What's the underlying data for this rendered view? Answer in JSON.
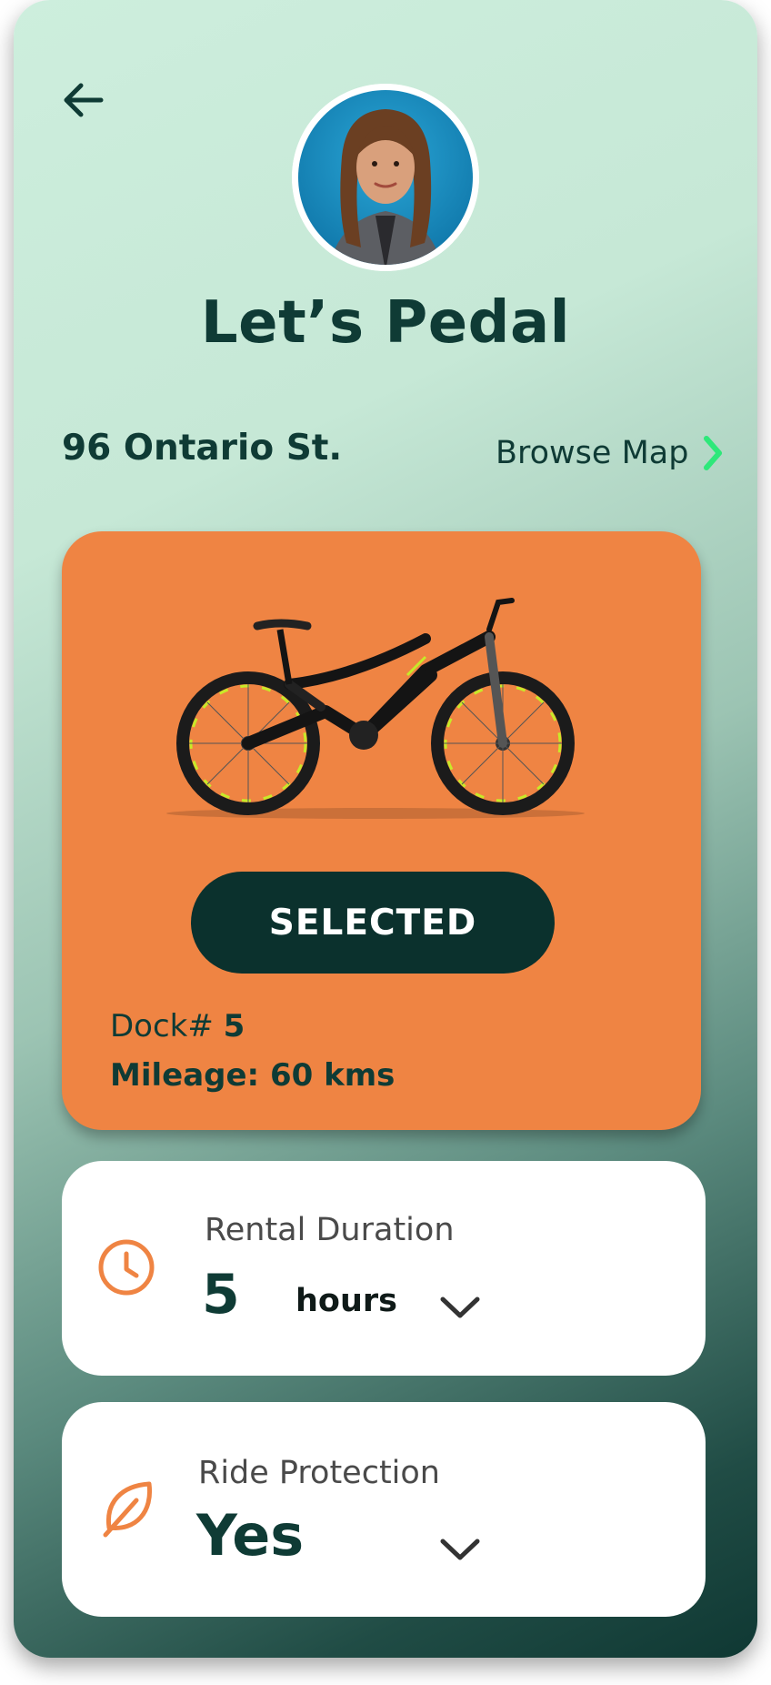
{
  "header": {
    "back_icon": "arrow-left-icon",
    "title": "Let’s Pedal"
  },
  "location": {
    "address": "96 Ontario St.",
    "browse_label": "Browse Map",
    "browse_icon": "chevron-right-icon"
  },
  "bike": {
    "status_label": "SELECTED",
    "dock_label": "Dock#",
    "dock_value": "5",
    "mileage": "Mileage: 60 kms"
  },
  "rental": {
    "label": "Rental Duration",
    "value": "5",
    "unit": "hours",
    "icon": "clock-icon"
  },
  "protection": {
    "label": "Ride Protection",
    "value": "Yes",
    "icon": "leaf-icon"
  },
  "colors": {
    "accent_orange": "#ef8443",
    "dark_green": "#0b312d",
    "bg_mint": "#cdeedd",
    "chevron_green": "#2ee87a"
  }
}
